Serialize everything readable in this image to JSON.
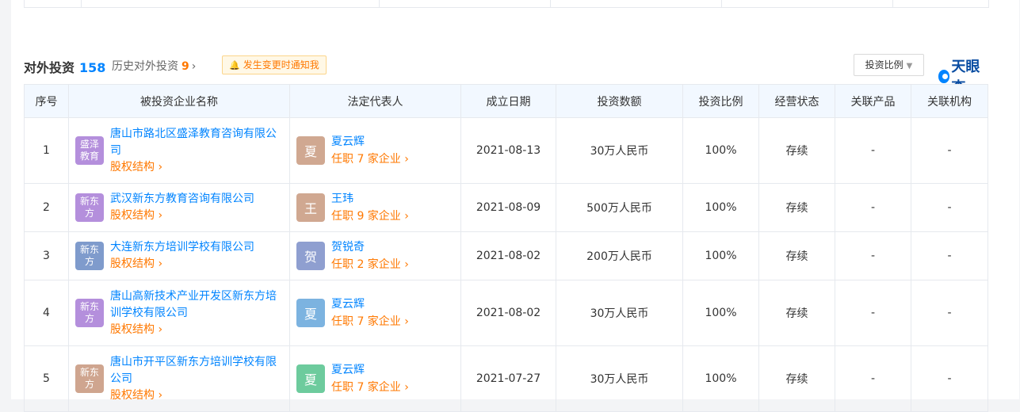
{
  "section": {
    "title": "对外投资",
    "count": "158",
    "history_label": "历史对外投资",
    "history_count": "9",
    "notify_label": "发生变更时通知我",
    "ratio_select": "投资比例",
    "brand": "天眼查"
  },
  "columns": [
    "序号",
    "被投资企业名称",
    "法定代表人",
    "成立日期",
    "投资数额",
    "投资比例",
    "经营状态",
    "关联产品",
    "关联机构"
  ],
  "rows": [
    {
      "index": "1",
      "logo_text": "盛泽教育",
      "logo_color": "#b48fdc",
      "company": "唐山市路北区盛泽教育咨询有限公司",
      "equity": "股权结构",
      "avatar": "夏",
      "avatar_color": "#d0a891",
      "rep": "夏云辉",
      "jobs": "任职 7 家企业",
      "date": "2021-08-13",
      "amount": "30万人民币",
      "ratio": "100%",
      "status": "存续",
      "product": "-",
      "org": "-"
    },
    {
      "index": "2",
      "logo_text": "新东方",
      "logo_color": "#b48fdc",
      "company": "武汉新东方教育咨询有限公司",
      "equity": "股权结构",
      "avatar": "王",
      "avatar_color": "#d0a891",
      "rep": "王玮",
      "jobs": "任职 9 家企业",
      "date": "2021-08-09",
      "amount": "500万人民币",
      "ratio": "100%",
      "status": "存续",
      "product": "-",
      "org": "-"
    },
    {
      "index": "3",
      "logo_text": "新东方",
      "logo_color": "#7f9bcc",
      "company": "大连新东方培训学校有限公司",
      "equity": "股权结构",
      "avatar": "贺",
      "avatar_color": "#8f9fd0",
      "rep": "贺锐奇",
      "jobs": "任职 2 家企业",
      "date": "2021-08-02",
      "amount": "200万人民币",
      "ratio": "100%",
      "status": "存续",
      "product": "-",
      "org": "-"
    },
    {
      "index": "4",
      "logo_text": "新东方",
      "logo_color": "#b48fdc",
      "company": "唐山高新技术产业开发区新东方培训学校有限公司",
      "equity": "股权结构",
      "avatar": "夏",
      "avatar_color": "#7cb3e0",
      "rep": "夏云辉",
      "jobs": "任职 7 家企业",
      "date": "2021-08-02",
      "amount": "30万人民币",
      "ratio": "100%",
      "status": "存续",
      "product": "-",
      "org": "-"
    },
    {
      "index": "5",
      "logo_text": "新东方",
      "logo_color": "#cfa58f",
      "company": "唐山市开平区新东方培训学校有限公司",
      "equity": "股权结构",
      "avatar": "夏",
      "avatar_color": "#6dcb9d",
      "rep": "夏云辉",
      "jobs": "任职 7 家企业",
      "date": "2021-07-27",
      "amount": "30万人民币",
      "ratio": "100%",
      "status": "存续",
      "product": "-",
      "org": "-"
    }
  ]
}
